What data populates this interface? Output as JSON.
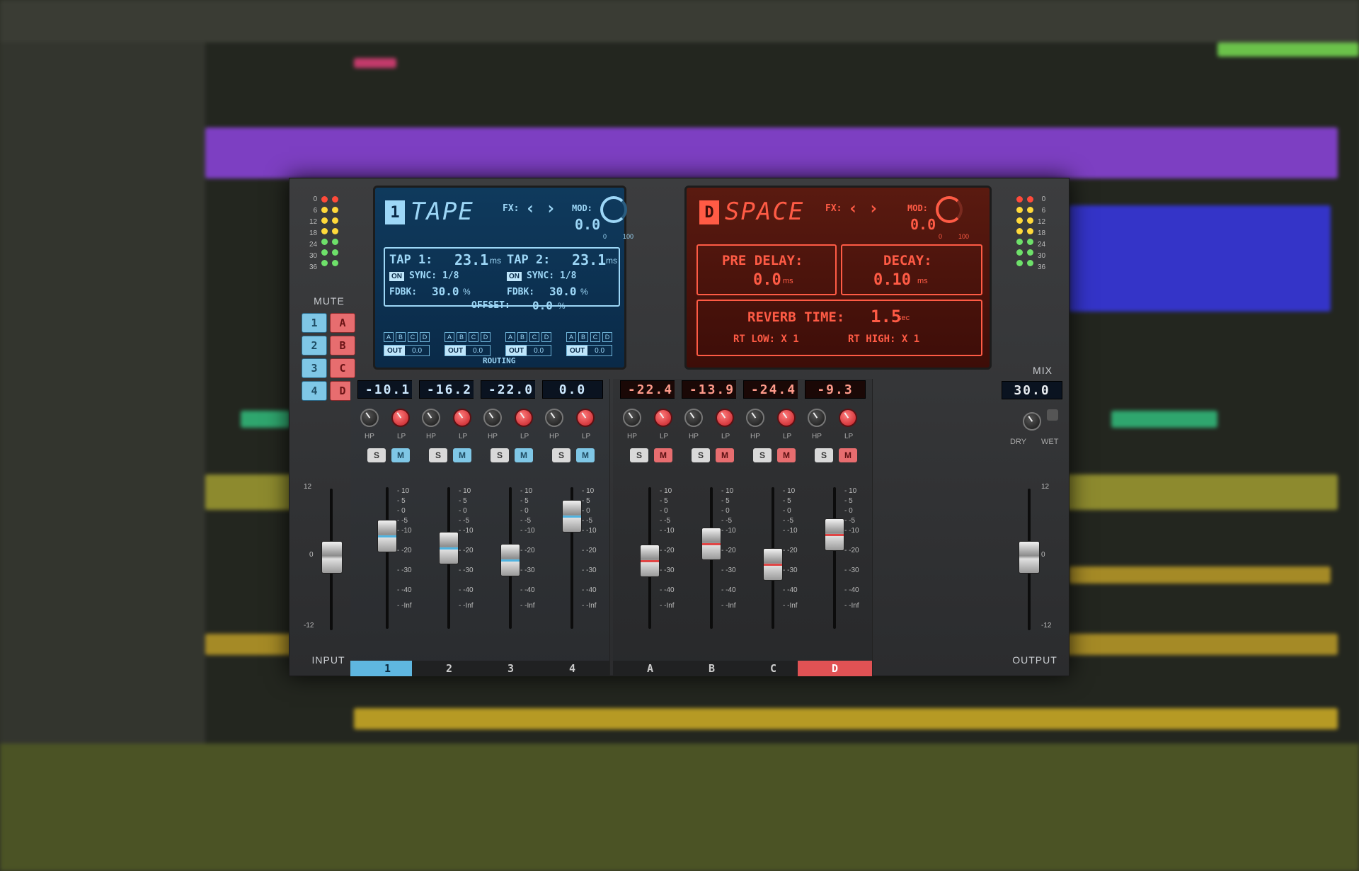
{
  "colors": {
    "blue_accent": "#7fc7e6",
    "red_accent": "#e76d6f",
    "blue_screen": "#0f3a5d",
    "red_screen": "#5a1a10"
  },
  "meter_scale": [
    "0",
    "6",
    "12",
    "18",
    "24",
    "30",
    "36"
  ],
  "mute": {
    "label": "MUTE",
    "blue": [
      "1",
      "2",
      "3",
      "4"
    ],
    "red": [
      "A",
      "B",
      "C",
      "D"
    ]
  },
  "tape": {
    "badge": "1",
    "title": "TAPE",
    "fx_label": "FX:",
    "mod_label": "MOD:",
    "mod_value": "0.0",
    "mod_min": "0",
    "mod_max": "100",
    "tap1": {
      "label": "TAP 1:",
      "value": "23.1",
      "unit": "ms",
      "sync_on": "ON",
      "sync": "SYNC: 1/8",
      "fdbk_label": "FDBK:",
      "fdbk": "30.0",
      "fdbk_unit": "%"
    },
    "tap2": {
      "label": "TAP 2:",
      "value": "23.1",
      "unit": "ms",
      "sync_on": "ON",
      "sync": "SYNC: 1/8",
      "fdbk_label": "FDBK:",
      "fdbk": "30.0",
      "fdbk_unit": "%"
    },
    "offset_label": "OFFSET:",
    "offset": "0.0",
    "offset_unit": "%",
    "routing_letters": [
      "A",
      "B",
      "C",
      "D"
    ],
    "out_label": "OUT",
    "out_value": "0.0",
    "routing_label": "ROUTING"
  },
  "space": {
    "badge": "D",
    "title": "SPACE",
    "fx_label": "FX:",
    "mod_label": "MOD:",
    "mod_value": "0.0",
    "mod_min": "0",
    "mod_max": "100",
    "pre_delay_label": "PRE DELAY:",
    "pre_delay": "0.0",
    "pre_delay_unit": "ms",
    "decay_label": "DECAY:",
    "decay": "0.10",
    "decay_unit": "ms",
    "reverb_time_label": "REVERB TIME:",
    "reverb_time": "1.5",
    "reverb_time_unit": "sec",
    "rt_low": "RT LOW: X 1",
    "rt_high": "RT HIGH: X 1"
  },
  "channels": [
    {
      "name": "1",
      "value": "-10.1",
      "level_db": -10.1
    },
    {
      "name": "2",
      "value": "-16.2",
      "level_db": -16.2
    },
    {
      "name": "3",
      "value": "-22.0",
      "level_db": -22.0
    },
    {
      "name": "4",
      "value": "0.0",
      "level_db": 0.0
    },
    {
      "name": "A",
      "value": "-22.4",
      "level_db": -22.4
    },
    {
      "name": "B",
      "value": "-13.9",
      "level_db": -13.9
    },
    {
      "name": "C",
      "value": "-24.4",
      "level_db": -24.4
    },
    {
      "name": "D",
      "value": "-9.3",
      "level_db": -9.3
    }
  ],
  "strip_labels": {
    "hp": "HP",
    "lp": "LP",
    "solo": "S",
    "mute": "M"
  },
  "fader_scale": [
    "10",
    "5",
    "0",
    "-5",
    "-10",
    "-20",
    "-30",
    "-40",
    "-Inf"
  ],
  "side_scale": [
    "12",
    "0",
    "-12"
  ],
  "input_label": "INPUT",
  "output_label": "OUTPUT",
  "mix": {
    "label": "MIX",
    "value": "30.0",
    "dry": "DRY",
    "wet": "WET"
  }
}
